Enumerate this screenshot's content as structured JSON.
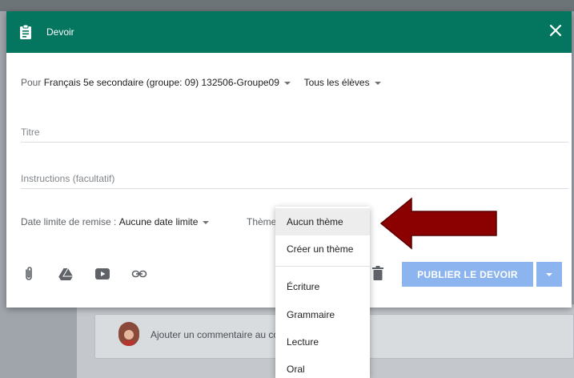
{
  "dialog": {
    "title": "Devoir",
    "header_color": "#047660",
    "pour_label": "Pour",
    "class_value": "Français 5e secondaire (groupe: 09) 132506-Groupe09",
    "students_value": "Tous les élèves",
    "title_placeholder": "Titre",
    "instructions_placeholder": "Instructions (facultatif)",
    "due_label": "Date limite de remise :",
    "due_value": "Aucune date limite",
    "theme_label": "Thème",
    "publish_label": "PUBLIER LE DEVOIR",
    "publish_color": "#8cb4ee"
  },
  "theme_menu": {
    "items": [
      {
        "label": "Aucun thème",
        "selected": true
      },
      {
        "label": "Créer un thème",
        "selected": false
      },
      {
        "label": "Écriture",
        "selected": false
      },
      {
        "label": "Grammaire",
        "selected": false
      },
      {
        "label": "Lecture",
        "selected": false
      },
      {
        "label": "Oral",
        "selected": false
      }
    ]
  },
  "toolbar_icons": [
    "paperclip-icon",
    "drive-icon",
    "youtube-icon",
    "link-icon"
  ],
  "background": {
    "comment_placeholder": "Ajouter un commentaire au co"
  },
  "annotation": {
    "arrow_color": "#8b0000"
  }
}
